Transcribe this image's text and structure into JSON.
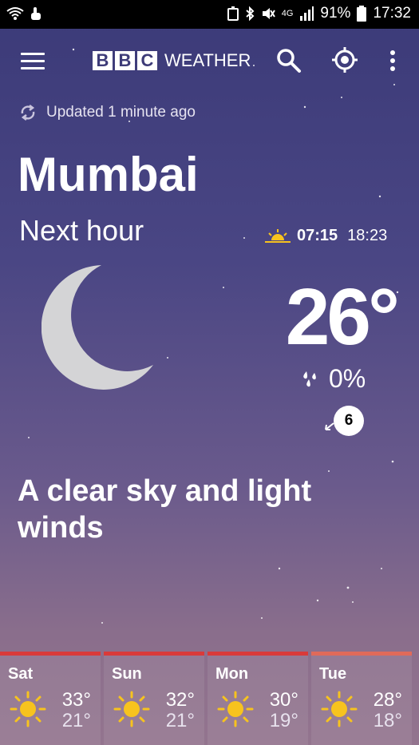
{
  "status_bar": {
    "battery": "91%",
    "time": "17:32",
    "network": "4G"
  },
  "header": {
    "logo_letters": [
      "B",
      "B",
      "C"
    ],
    "logo_word": "WEATHER",
    "icons": [
      "menu-icon",
      "search-icon",
      "location-icon",
      "more-icon"
    ]
  },
  "updated": "Updated 1 minute ago",
  "city": "Mumbai",
  "period": "Next hour",
  "sunrise": "07:15",
  "sunset": "18:23",
  "temperature": "26°",
  "precipitation": "0%",
  "wind_speed": "6",
  "description": "A clear sky and light winds",
  "forecast": [
    {
      "day": "Sat",
      "high": "33°",
      "low": "21°",
      "icon": "sun-icon"
    },
    {
      "day": "Sun",
      "high": "32°",
      "low": "21°",
      "icon": "sun-icon"
    },
    {
      "day": "Mon",
      "high": "30°",
      "low": "19°",
      "icon": "sun-icon"
    },
    {
      "day": "Tue",
      "high": "28°",
      "low": "18°",
      "icon": "sun-icon"
    }
  ],
  "colors": {
    "sun": "#f7c31e",
    "forecast_accent": "#d93a3a",
    "background_top": "#3b3a78"
  }
}
